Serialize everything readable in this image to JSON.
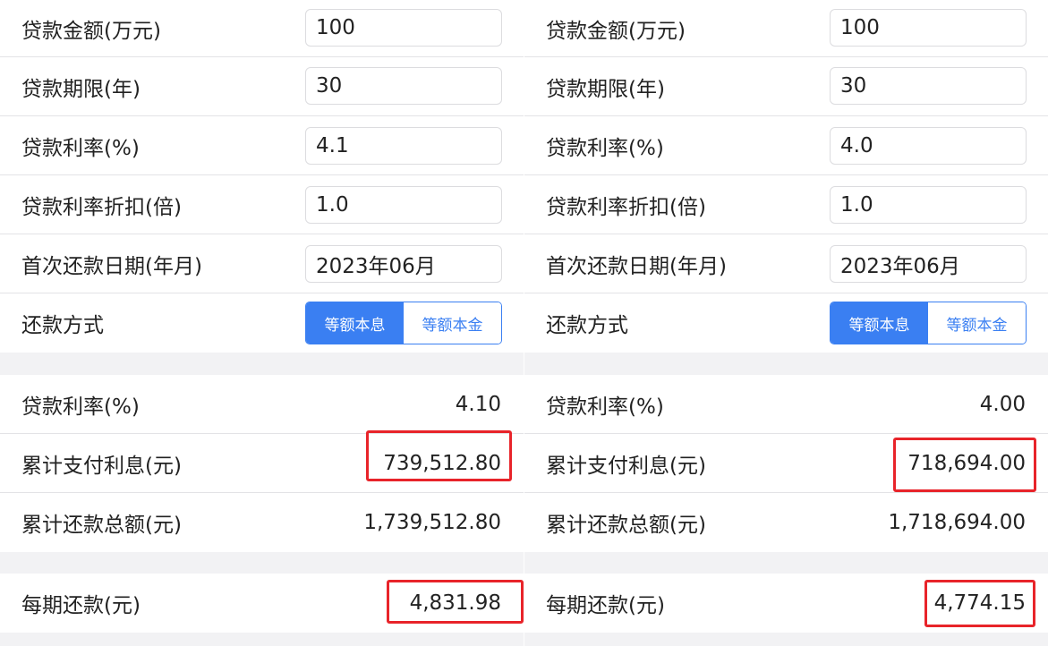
{
  "panels": [
    {
      "inputs": {
        "amount": {
          "label": "贷款金额(万元)",
          "value": "100"
        },
        "term": {
          "label": "贷款期限(年)",
          "value": "30"
        },
        "rate": {
          "label": "贷款利率(%)",
          "value": "4.1"
        },
        "discount": {
          "label": "贷款利率折扣(倍)",
          "value": "1.0"
        },
        "first_date": {
          "label": "首次还款日期(年月)",
          "value": "2023年06月"
        },
        "method": {
          "label": "还款方式",
          "options": [
            "等额本息",
            "等额本金"
          ],
          "selected": "等额本息"
        }
      },
      "results": {
        "rate": {
          "label": "贷款利率(%)",
          "value": "4.10"
        },
        "total_interest": {
          "label": "累计支付利息(元)",
          "value": "739,512.80"
        },
        "total_payment": {
          "label": "累计还款总额(元)",
          "value": "1,739,512.80"
        }
      },
      "monthly": {
        "label": "每期还款(元)",
        "value": "4,831.98"
      }
    },
    {
      "inputs": {
        "amount": {
          "label": "贷款金额(万元)",
          "value": "100"
        },
        "term": {
          "label": "贷款期限(年)",
          "value": "30"
        },
        "rate": {
          "label": "贷款利率(%)",
          "value": "4.0"
        },
        "discount": {
          "label": "贷款利率折扣(倍)",
          "value": "1.0"
        },
        "first_date": {
          "label": "首次还款日期(年月)",
          "value": "2023年06月"
        },
        "method": {
          "label": "还款方式",
          "options": [
            "等额本息",
            "等额本金"
          ],
          "selected": "等额本息"
        }
      },
      "results": {
        "rate": {
          "label": "贷款利率(%)",
          "value": "4.00"
        },
        "total_interest": {
          "label": "累计支付利息(元)",
          "value": "718,694.00"
        },
        "total_payment": {
          "label": "累计还款总额(元)",
          "value": "1,718,694.00"
        }
      },
      "monthly": {
        "label": "每期还款(元)",
        "value": "4,774.15"
      }
    }
  ],
  "colors": {
    "accent": "#3a7ff2",
    "highlight": "#e8242a",
    "separator": "#f2f2f4"
  }
}
